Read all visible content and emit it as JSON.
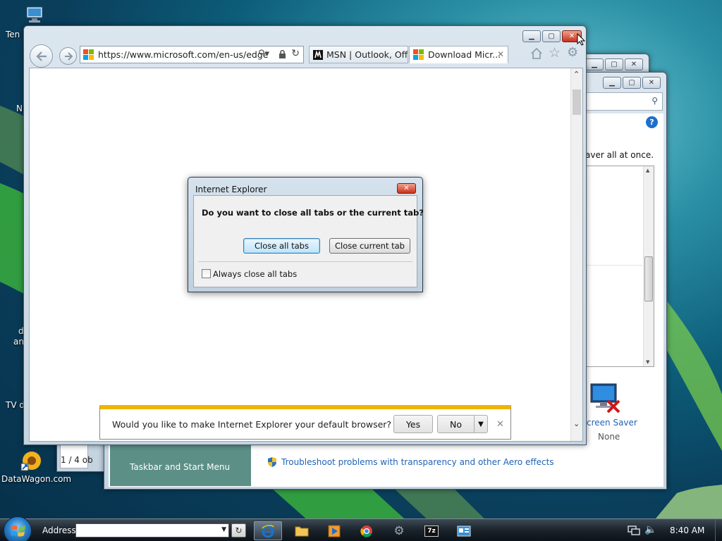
{
  "desktop": {
    "icons": [
      {
        "label": "Ten l"
      },
      {
        "label": "N"
      },
      {
        "label": "d"
      },
      {
        "label": "an"
      },
      {
        "label": "TV d"
      },
      {
        "label": "DataWagon.com"
      }
    ],
    "status_fragment": "1 / 4 ob"
  },
  "ie": {
    "address": "https://www.microsoft.com/en-us/edge",
    "tabs": [
      {
        "label": "MSN | Outlook, Off..."
      },
      {
        "label": "Download Micr..."
      }
    ],
    "tab_close": "✕"
  },
  "dialog": {
    "title": "Internet Explorer",
    "question": "Do you want to close all tabs or the current tab?",
    "close_all_label": "Close all tabs",
    "close_current_label": "Close current tab",
    "always_close_label": "Always close all tabs",
    "always_close_checked": false
  },
  "notification": {
    "message": "Would you like to make Internet Explorer your default browser?",
    "yes_label": "Yes",
    "no_label": "No"
  },
  "personalize": {
    "fragment_text": "aver all at once.",
    "screen_saver_label": "creen Saver",
    "screen_saver_value": "None",
    "taskbar_link": "Taskbar and Start Menu",
    "troubleshoot_link": "Troubleshoot problems with transparency and other Aero effects"
  },
  "taskbar": {
    "address_label": "Address",
    "address_value": "",
    "clock": "8:40 AM"
  },
  "colors": {
    "ie_blue": "#1a73c9",
    "link_blue": "#1f64b6",
    "notif_bar": "#f0b400",
    "help_blue": "#1f6fc9"
  }
}
